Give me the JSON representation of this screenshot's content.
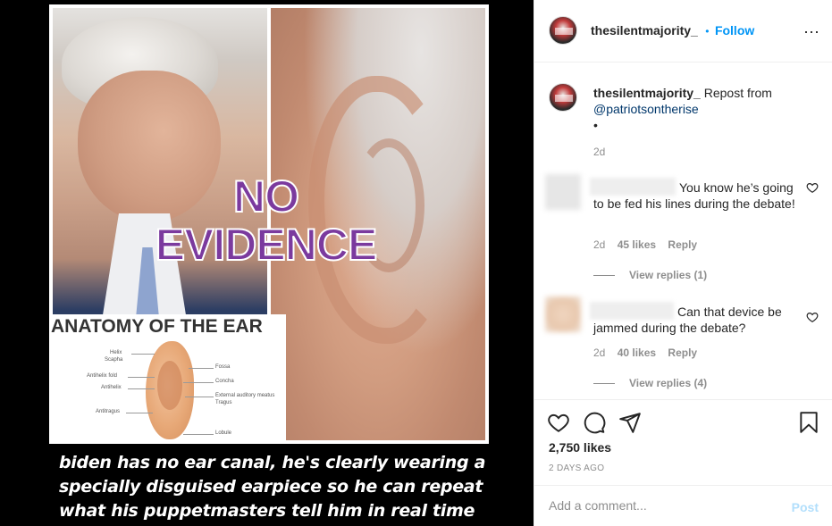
{
  "post_image": {
    "overlay_text_line1": "NO",
    "overlay_text_line2": "EVIDENCE",
    "anatomy_title": "ANATOMY OF THE EAR",
    "ear_labels_left": [
      "Helix",
      "Scapha",
      "Antihelix fold",
      "Antihelix",
      "Antitragus"
    ],
    "ear_labels_right": [
      "Fossa",
      "Concha",
      "External auditory meatus",
      "Tragus",
      "Lobule"
    ],
    "caption_lines": [
      "biden has no ear canal, he's clearly wearing a",
      "specially disguised earpiece so he can repeat",
      "what his puppetmasters tell him in real time"
    ]
  },
  "header": {
    "username": "thesilentmajority_",
    "separator": "•",
    "follow_label": "Follow",
    "more_icon": "⋯"
  },
  "caption": {
    "username": "thesilentmajority_",
    "text": "Repost from",
    "mention": "@patriotsontherise",
    "bullet": "•",
    "time": "2d"
  },
  "comments": [
    {
      "text": "You know he’s going to be fed his lines during the debate!",
      "time": "2d",
      "likes": "45 likes",
      "reply_label": "Reply",
      "view_replies": "View replies (1)"
    },
    {
      "text": "Can that device be jammed during the debate?",
      "time": "2d",
      "likes": "40 likes",
      "reply_label": "Reply",
      "view_replies": "View replies (4)"
    }
  ],
  "actions": {
    "like_icon": "heart-icon",
    "comment_icon": "comment-icon",
    "share_icon": "share-icon",
    "save_icon": "bookmark-icon",
    "likes_count": "2,750 likes",
    "date": "2 DAYS AGO"
  },
  "add_comment": {
    "placeholder": "Add a comment...",
    "post_label": "Post"
  },
  "colors": {
    "accent": "#0095f6",
    "overlay_purple": "#7b3a9e",
    "post_disabled": "#b2dffc"
  }
}
